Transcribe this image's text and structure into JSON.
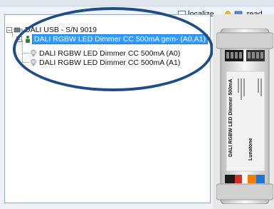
{
  "toolbar": {
    "localize_label": "localize",
    "read_label": "read"
  },
  "tree": {
    "root_label": "DALI USB - S/N 9019",
    "group_label": "DALI RGBW LED Dimmer CC 500mA gem- (A0,A1)",
    "children": [
      "DALI RGBW LED Dimmer CC 500mA (A0)",
      "DALI RGBW LED Dimmer CC 500mA (A1)"
    ]
  },
  "device_image": {
    "brand": "Lunatone",
    "model_text": "DALI RGBW LED Dimmer 500mA"
  },
  "colors": {
    "selection": "#3399ff",
    "highlight_oval": "#1f4e86"
  }
}
